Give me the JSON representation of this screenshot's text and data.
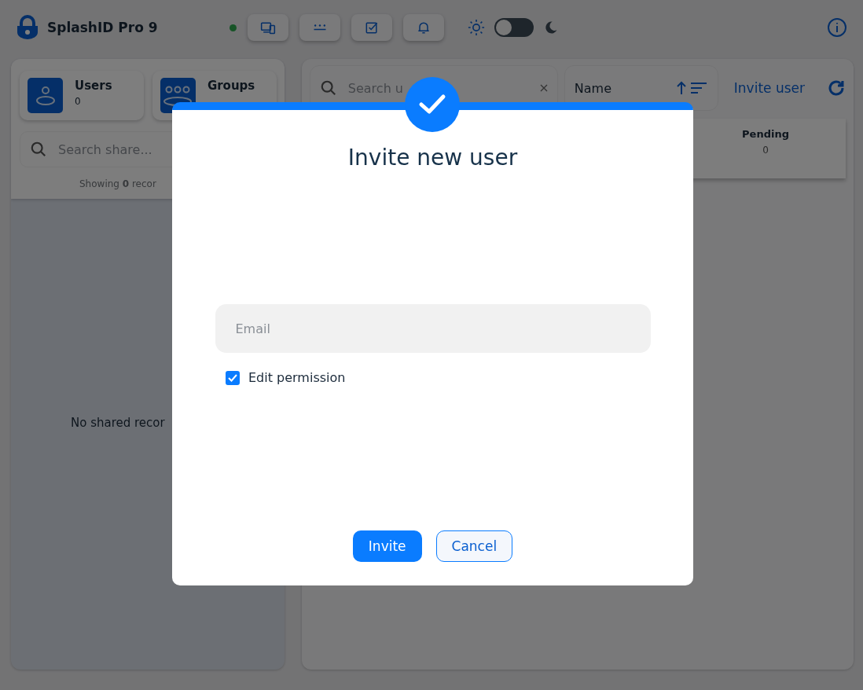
{
  "app": {
    "title": "SplashID Pro 9",
    "online": true
  },
  "toolbar": [
    {
      "kind": "devices"
    },
    {
      "kind": "password"
    },
    {
      "kind": "tasks"
    },
    {
      "kind": "notifications"
    }
  ],
  "theme": {
    "dark": false
  },
  "sidebar": {
    "cards": [
      {
        "kind": "user",
        "label": "Users",
        "count": "0"
      },
      {
        "kind": "group",
        "label": "Groups"
      }
    ],
    "search": {
      "placeholder": "Search share..."
    },
    "summary": "Showing **0** recor",
    "empty_message": "No shared recor"
  },
  "main": {
    "search": {
      "placeholder": "Search u"
    },
    "sort": {
      "field": "Name"
    },
    "invite_link": "Invite user",
    "stats": [
      {
        "label": "Pending",
        "value": "0"
      }
    ]
  },
  "dialog": {
    "title": "Invite new user",
    "email": {
      "placeholder": "Email"
    },
    "permission": {
      "label": "Edit permission",
      "checked": true
    },
    "buttons": [
      {
        "label": "Invite",
        "kind": "primary"
      },
      {
        "label": "Cancel",
        "kind": "secondary"
      }
    ]
  }
}
